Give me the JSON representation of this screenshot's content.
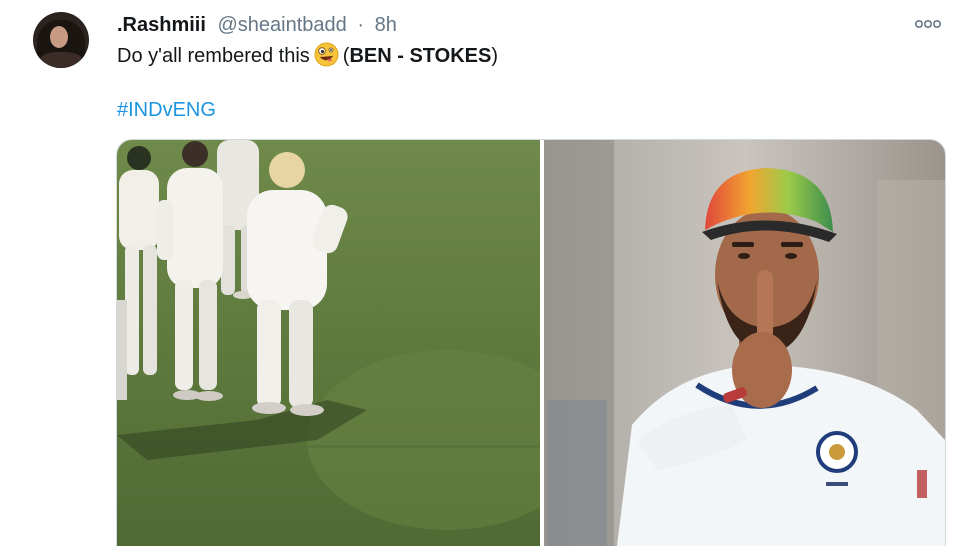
{
  "tweet": {
    "display_name": ".Rashmiii",
    "handle": "@sheaintbadd",
    "separator": "·",
    "time": "8h",
    "text_before_emoji": "Do y'all rembered this",
    "emoji_name": "zany-face",
    "paren_open": "(",
    "bold_text": "BEN - STOKES",
    "paren_close": ")",
    "hashtag": "#INDvENG"
  },
  "colors": {
    "text": "#14171a",
    "secondary": "#657786",
    "link": "#1b95e0",
    "border": "#cfd9de"
  },
  "icons": {
    "more": "more-options-icon",
    "avatar": "profile-avatar"
  },
  "media": {
    "left_image": "cricket-players-on-field",
    "right_image": "cricketer-finger-on-lips"
  }
}
